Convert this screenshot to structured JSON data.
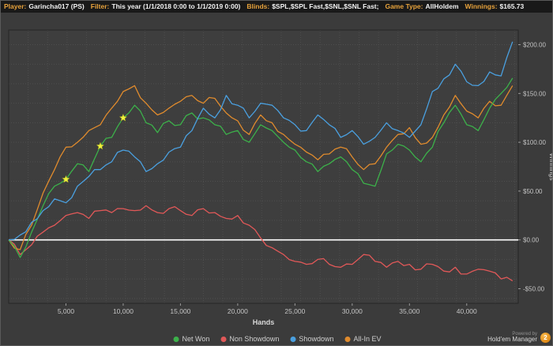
{
  "top_bar": {
    "player_label": "Player:",
    "player_value": "Garincha017 (PS)",
    "filter_label": "Filter:",
    "filter_value": "This year (1/1/2018 0:00 to 1/1/2019 0:00)",
    "blinds_label": "Blinds:",
    "blinds_value": "$SPL,$SPL Fast,$SNL,$SNL Fast;",
    "gametype_label": "Game Type:",
    "gametype_value": "AllHoldem",
    "winnings_label": "Winnings:",
    "winnings_value": "$165.73"
  },
  "chart_data": {
    "type": "line",
    "title": "",
    "xlabel": "Hands",
    "ylabel": "Winnings",
    "xlim": [
      0,
      44500
    ],
    "ylim": [
      -65,
      215
    ],
    "grid": true,
    "x_tick_values": [
      5000,
      10000,
      15000,
      20000,
      25000,
      30000,
      35000,
      40000
    ],
    "x_tick_labels": [
      "5,000",
      "10,000",
      "15,000",
      "20,000",
      "25,000",
      "30,000",
      "35,000",
      "40,000"
    ],
    "y_tick_values": [
      -50,
      0,
      50,
      100,
      150,
      200
    ],
    "y_tick_labels": [
      "-$50.00",
      "$0.00",
      "$50.00",
      "$100.00",
      "$150.00",
      "$200.00"
    ],
    "zero_line": {
      "value": 0,
      "color": "#ffffff"
    },
    "x": [
      0,
      1000,
      2000,
      3000,
      4000,
      5000,
      6000,
      7000,
      8000,
      9000,
      10000,
      11000,
      12000,
      13000,
      14000,
      15000,
      16000,
      17000,
      18000,
      19000,
      20000,
      21000,
      22000,
      23000,
      24000,
      25000,
      26000,
      27000,
      28000,
      29000,
      30000,
      31000,
      32000,
      33000,
      34000,
      35000,
      36000,
      37000,
      38000,
      39000,
      40000,
      41000,
      42000,
      43000,
      44000
    ],
    "series": [
      {
        "name": "Net Won",
        "color": "#3cb14a",
        "y": [
          0,
          -18,
          8,
          35,
          55,
          62,
          78,
          70,
          96,
          105,
          125,
          138,
          120,
          110,
          122,
          118,
          130,
          125,
          118,
          108,
          112,
          100,
          118,
          112,
          100,
          92,
          80,
          70,
          78,
          85,
          72,
          58,
          55,
          88,
          98,
          92,
          80,
          95,
          120,
          138,
          118,
          112,
          135,
          150,
          165.7
        ]
      },
      {
        "name": "Non Showdown",
        "color": "#e15858",
        "y": [
          0,
          -15,
          -5,
          8,
          15,
          25,
          28,
          22,
          30,
          28,
          32,
          30,
          35,
          28,
          32,
          30,
          25,
          32,
          28,
          22,
          25,
          15,
          2,
          -8,
          -15,
          -22,
          -25,
          -20,
          -25,
          -28,
          -25,
          -15,
          -22,
          -28,
          -22,
          -25,
          -30,
          -25,
          -32,
          -28,
          -35,
          -30,
          -32,
          -40,
          -42
        ]
      },
      {
        "name": "Showdown",
        "color": "#4aa0e0",
        "y": [
          0,
          5,
          18,
          30,
          42,
          38,
          55,
          65,
          72,
          80,
          92,
          85,
          70,
          78,
          90,
          95,
          112,
          135,
          125,
          148,
          138,
          125,
          140,
          138,
          125,
          118,
          112,
          128,
          118,
          105,
          112,
          98,
          105,
          120,
          112,
          105,
          118,
          152,
          165,
          180,
          162,
          158,
          172,
          168,
          203
        ]
      },
      {
        "name": "All-In EV",
        "color": "#e08b2d",
        "y": [
          0,
          -10,
          15,
          48,
          72,
          95,
          100,
          112,
          118,
          135,
          152,
          158,
          140,
          128,
          135,
          142,
          148,
          140,
          145,
          130,
          122,
          108,
          128,
          120,
          108,
          98,
          90,
          82,
          88,
          95,
          85,
          72,
          78,
          95,
          108,
          115,
          98,
          105,
          128,
          148,
          132,
          125,
          142,
          138,
          158
        ]
      }
    ],
    "markers": {
      "shape": "star",
      "color": "#eef23c",
      "points": [
        [
          5000,
          62
        ],
        [
          8000,
          96
        ],
        [
          10000,
          125
        ]
      ]
    },
    "legend_position": "bottom"
  },
  "footer": {
    "powered_by": "Powered by",
    "brand": "Hold'em Manager",
    "brand_badge": "2"
  }
}
